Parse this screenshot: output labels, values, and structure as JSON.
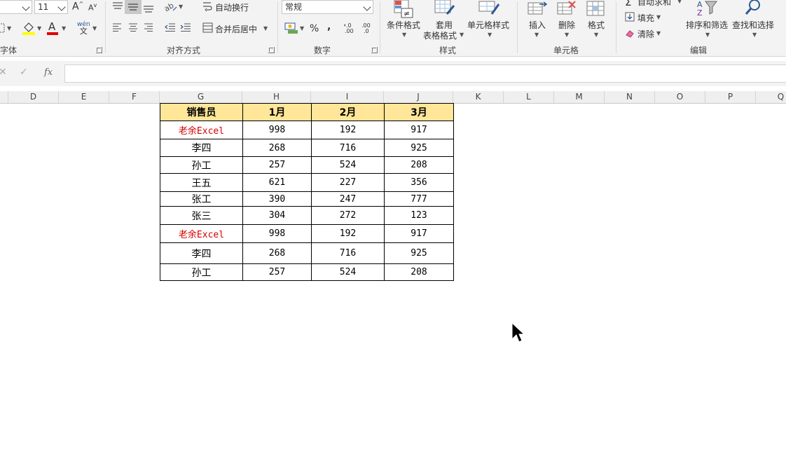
{
  "ribbon": {
    "font_group": {
      "label": "字体",
      "font_size": "11",
      "grow_label": "A",
      "shrink_label": "A",
      "phonetic_label": "wén",
      "phonetic_sub": "文",
      "font_color_letter": "A"
    },
    "align_group": {
      "label": "对齐方式",
      "wrap_text": "自动换行",
      "merge_center": "合并后居中"
    },
    "number_group": {
      "label": "数字",
      "format_value": "常规",
      "percent": "%",
      "comma": ",",
      "inc_decimal": ".00",
      "dec_decimal": ".00"
    },
    "styles_group": {
      "label": "样式",
      "conditional_format": "条件格式",
      "format_table_line1": "套用",
      "format_table_line2": "表格格式",
      "cell_styles": "单元格样式"
    },
    "cells_group": {
      "label": "单元格",
      "insert": "插入",
      "delete": "删除",
      "format": "格式"
    },
    "edit_group": {
      "label": "编辑",
      "autosum": "自动求和",
      "fill": "填充",
      "clear": "清除",
      "sort_filter": "排序和筛选",
      "find_select": "查找和选择"
    }
  },
  "formula_bar": {
    "fx_label": "fx",
    "value": ""
  },
  "columns": [
    "D",
    "E",
    "F",
    "G",
    "H",
    "I",
    "J",
    "K",
    "L",
    "M",
    "N",
    "O",
    "P",
    "Q"
  ],
  "table": {
    "headers": [
      "销售员",
      "1月",
      "2月",
      "3月"
    ],
    "rows": [
      [
        "老余Excel",
        "998",
        "192",
        "917"
      ],
      [
        "李四",
        "268",
        "716",
        "925"
      ],
      [
        "孙工",
        "257",
        "524",
        "208"
      ],
      [
        "王五",
        "621",
        "227",
        "356"
      ],
      [
        "张工",
        "390",
        "247",
        "777"
      ],
      [
        "张三",
        "304",
        "272",
        "123"
      ],
      [
        "老余Excel",
        "998",
        "192",
        "917"
      ],
      [
        "李四",
        "268",
        "716",
        "925"
      ],
      [
        "孙工",
        "257",
        "524",
        "208"
      ]
    ]
  },
  "colors": {
    "header_fill": "#ffe699",
    "highlight_text": "#d40000",
    "font_color_bar": "#e00000",
    "fill_color_bar": "#ffff00",
    "accent": "#217346"
  }
}
